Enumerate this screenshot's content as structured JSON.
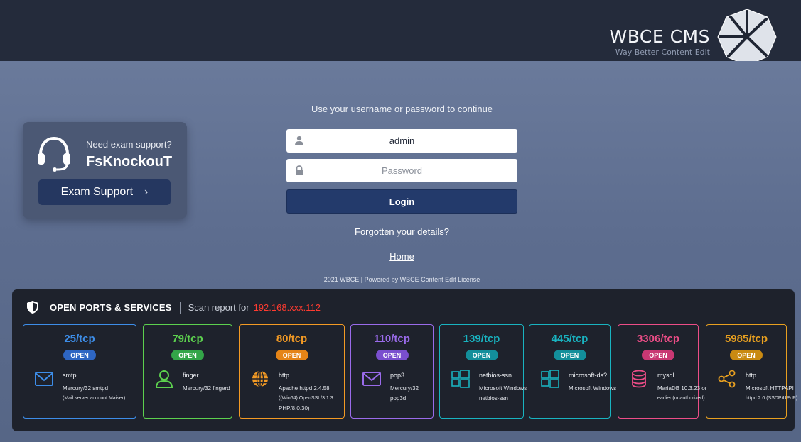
{
  "header": {
    "brand_name": "WBCE CMS",
    "brand_tagline": "Way Better Content Edit"
  },
  "support": {
    "question": "Need exam support?",
    "name": "FsKnockouT",
    "button_label": "Exam Support",
    "button_chevron": "›"
  },
  "login": {
    "prompt": "Use your username or password to continue",
    "username_value": "admin",
    "password_placeholder": "Password",
    "login_label": "Login",
    "forgot_label": "Forgotten your details?",
    "home_label": "Home",
    "footer": "2021 WBCE | Powered by WBCE Content Edit License"
  },
  "ports": {
    "title": "OPEN PORTS & SERVICES",
    "subtitle": "Scan report for",
    "ip": "192.168.xxx.112",
    "cards": [
      {
        "port": "25/tcp",
        "status": "OPEN",
        "service": "smtp",
        "icon": "mail-icon",
        "color": "#3d8de8",
        "badge": "#2e66c3",
        "lines": [
          "Mercury/32 smtpd",
          "(Mail server account Maiser)"
        ]
      },
      {
        "port": "79/tcp",
        "status": "OPEN",
        "service": "finger",
        "icon": "user-icon",
        "color": "#5cd04e",
        "badge": "#33a548",
        "lines": [
          "Mercury/32 fingerd"
        ]
      },
      {
        "port": "80/tcp",
        "status": "OPEN",
        "service": "http",
        "icon": "globe-icon",
        "color": "#f39a24",
        "badge": "#e58417",
        "lines": [
          "Apache httpd 2.4.58",
          "((Win64) OpenSSL/3.1.3",
          "PHP/8.0.30)"
        ]
      },
      {
        "port": "110/tcp",
        "status": "OPEN",
        "service": "pop3",
        "icon": "mail-icon",
        "color": "#9a6bea",
        "badge": "#7a4fcf",
        "lines": [
          "Mercury/32",
          "pop3d"
        ]
      },
      {
        "port": "139/tcp",
        "status": "OPEN",
        "service": "netbios-ssn",
        "icon": "windows-icon",
        "color": "#19b3c0",
        "badge": "#138f9b",
        "lines": [
          "Microsoft Windows",
          "netbios-ssn"
        ]
      },
      {
        "port": "445/tcp",
        "status": "OPEN",
        "service": "microsoft-ds?",
        "icon": "windows-icon",
        "color": "#19b3c0",
        "badge": "#138f9b",
        "lines": [
          "Microsoft Windows"
        ]
      },
      {
        "port": "3306/tcp",
        "status": "OPEN",
        "service": "mysql",
        "icon": "database-icon",
        "color": "#ec4d87",
        "badge": "#c93873",
        "lines": [
          "MariaDB 10.3.23 or",
          "earlier (unauthorized)"
        ]
      },
      {
        "port": "5985/tcp",
        "status": "OPEN",
        "service": "http",
        "icon": "share-icon",
        "color": "#e8a020",
        "badge": "#c98a12",
        "lines": [
          "Microsoft HTTPAPI",
          "httpd 2.0 (SSDP/UPnP)"
        ]
      }
    ]
  }
}
